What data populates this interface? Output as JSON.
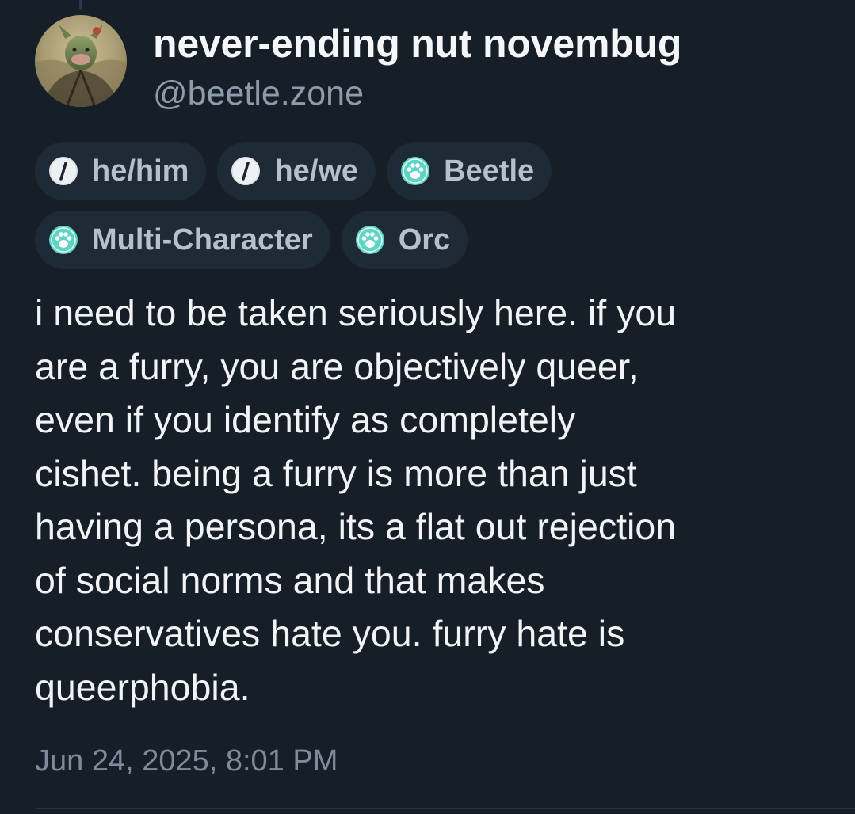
{
  "post": {
    "display_name": "never-ending nut novembug",
    "handle": "@beetle.zone",
    "avatar_icon": "beetle-avatar-image",
    "tags": [
      {
        "label": "he/him",
        "icon": "pronoun-icon"
      },
      {
        "label": "he/we",
        "icon": "pronoun-icon"
      },
      {
        "label": "Beetle",
        "icon": "paw-icon"
      },
      {
        "label": "Multi-Character",
        "icon": "paw-icon"
      },
      {
        "label": "Orc",
        "icon": "paw-icon"
      }
    ],
    "body_lines": [
      "i need to be taken seriously here. if you",
      "are a furry, you are objectively queer,",
      "even if you identify as completely",
      "cishet. being a furry is more than just",
      "having a persona, its a flat out rejection",
      "of social norms and that makes",
      "conservatives hate you. furry hate is",
      "queerphobia."
    ],
    "timestamp": "Jun 24, 2025, 8:01 PM"
  },
  "colors": {
    "background": "#161e27",
    "tag_background": "#1f2a37",
    "tag_text": "#b5c0cd",
    "paw_icon": "#5fd4c4",
    "muted_text": "#8f9bab"
  }
}
